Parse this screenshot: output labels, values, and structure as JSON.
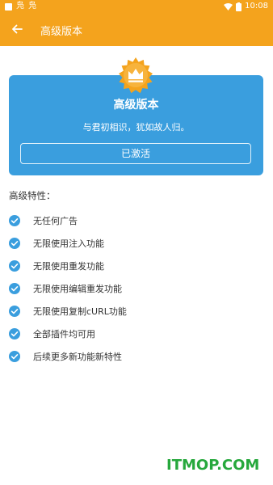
{
  "statusbar": {
    "time": "10:08",
    "left_glyphs": [
      "凫",
      "凫"
    ]
  },
  "toolbar": {
    "title": "高级版本"
  },
  "card": {
    "title": "高级版本",
    "motto": "与君初相识，犹如故人归。",
    "button": "已激活"
  },
  "features_title": "高级特性：",
  "features": [
    "无任何广告",
    "无限使用注入功能",
    "无限使用重发功能",
    "无限使用编辑重发功能",
    "无限使用复制cURL功能",
    "全部插件均可用",
    "后续更多新功能新特性"
  ],
  "watermark": "ITMOP.COM",
  "colors": {
    "accent": "#f4a31d",
    "card": "#3a9ede",
    "watermark": "#26a83c"
  }
}
